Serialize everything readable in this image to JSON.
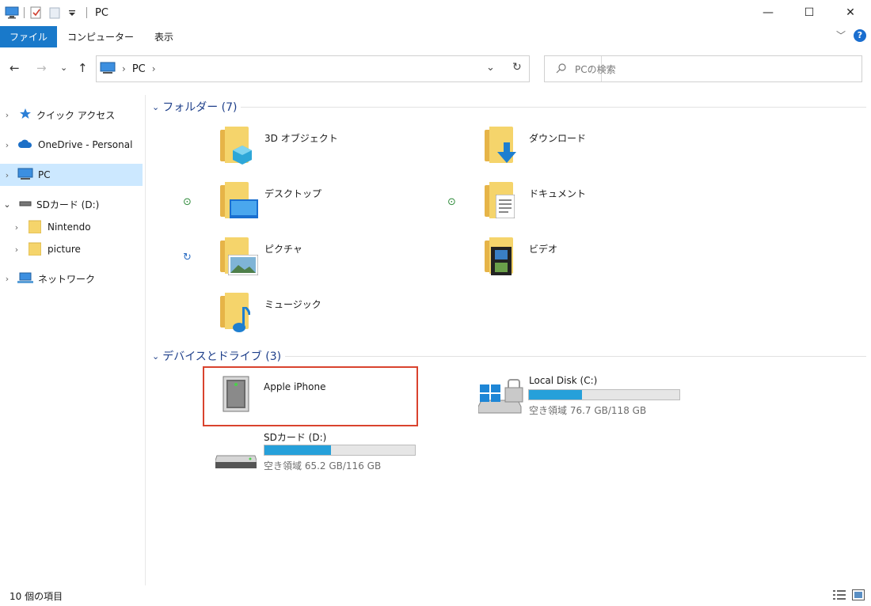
{
  "window": {
    "title": "PC",
    "minimize": "—",
    "maximize": "☐",
    "close": "✕"
  },
  "ribbon": {
    "tabs": [
      "ファイル",
      "コンピューター",
      "表示"
    ],
    "collapse": "﹀",
    "help": "?"
  },
  "address": {
    "back": "←",
    "forward": "→",
    "recent": "⌄",
    "up": "↑",
    "path_item": "PC",
    "path_sep": "›",
    "dropdown": "⌄",
    "refresh": "↻",
    "search_placeholder": "PCの検索"
  },
  "nav": {
    "items": [
      {
        "label": "クイック アクセス",
        "chevron": "›"
      },
      {
        "label": "OneDrive - Personal",
        "chevron": "›"
      },
      {
        "label": "PC",
        "chevron": "›"
      },
      {
        "label": "SDカード (D:)",
        "chevron": "⌄"
      },
      {
        "label": "Nintendo",
        "chevron": "›"
      },
      {
        "label": "picture",
        "chevron": "›"
      },
      {
        "label": "ネットワーク",
        "chevron": "›"
      }
    ]
  },
  "folders": {
    "header": "フォルダー (7)",
    "items": [
      {
        "label": "3D オブジェクト"
      },
      {
        "label": "ダウンロード"
      },
      {
        "label": "デスクトップ"
      },
      {
        "label": "ドキュメント"
      },
      {
        "label": "ピクチャ"
      },
      {
        "label": "ビデオ"
      },
      {
        "label": "ミュージック"
      }
    ]
  },
  "drives": {
    "header": "デバイスとドライブ (3)",
    "items": [
      {
        "label": "Apple iPhone"
      },
      {
        "label": "Local Disk (C:)",
        "free_text": "空き領域 76.7 GB/118 GB",
        "used_fraction": 0.35
      },
      {
        "label": "SDカード (D:)",
        "free_text": "空き領域 65.2 GB/116 GB",
        "used_fraction": 0.44
      }
    ]
  },
  "status": {
    "item_count": "10 個の項目"
  },
  "colors": {
    "accent": "#1979ca",
    "selection": "#cce8ff",
    "usage_fill": "#26a0da",
    "highlight": "#d9432e",
    "group_header": "#1e3f8a"
  }
}
